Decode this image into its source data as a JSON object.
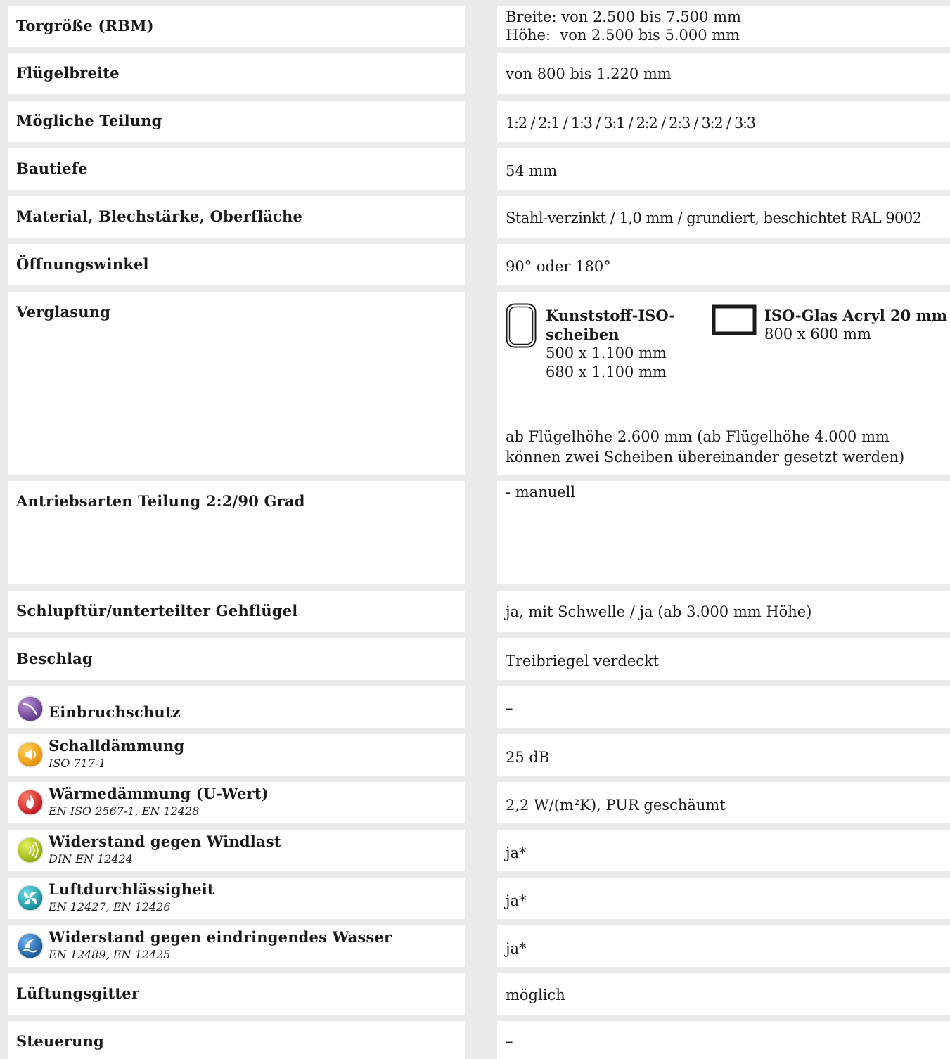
{
  "rows": [
    {
      "label": "Torgröße (RBM)",
      "value_line1": "Breite: von 2.500 bis 7.500 mm",
      "value_line2": "Höhe:  von 2.500 bis 5.000 mm"
    },
    {
      "label": "Flügelbreite",
      "value": "von 800 bis 1.220 mm"
    },
    {
      "label": "Mögliche Teilung",
      "value": "1:2 / 2:1 / 1:3 / 3:1 / 2:2 / 2:3 / 3:2 / 3:3"
    },
    {
      "label": "Bautiefe",
      "value": "54 mm"
    },
    {
      "label": "Material, Blechstärke, Oberfläche",
      "value": "Stahl-verzinkt / 1,0 mm / grundiert, beschichtet RAL 9002"
    },
    {
      "label": "Öffnungswinkel",
      "value": "90° oder 180°"
    },
    {
      "label": "Verglasung"
    },
    {
      "label": "Antriebsarten Teilung 2:2/90 Grad",
      "value": "- manuell"
    },
    {
      "label": "Schlupftür/unterteilter Gehflügel",
      "value": "ja, mit Schwelle / ja (ab 3.000 mm Höhe)"
    },
    {
      "label": "Beschlag",
      "value": "Treibriegel verdeckt"
    },
    {
      "label": "Einbruchschutz",
      "value": "–"
    },
    {
      "label": "Schalldämmung",
      "sub": "ISO 717-1",
      "value": "25 dB"
    },
    {
      "label": "Wärmedämmung (U-Wert)",
      "sub": "EN ISO 2567-1, EN 12428",
      "value": "2,2 W/(m²K), PUR geschäumt"
    },
    {
      "label": "Widerstand gegen Windlast",
      "sub": "DIN EN 12424",
      "value": "ja*"
    },
    {
      "label": "Luftdurchlässigheit",
      "sub": "EN 12427, EN 12426",
      "value": "ja*"
    },
    {
      "label": "Widerstand gegen eindringendes Wasser",
      "sub": "EN 12489, EN 12425",
      "value": "ja*"
    },
    {
      "label": "Lüftungsgitter",
      "value": "möglich"
    },
    {
      "label": "Steuerung",
      "value": "–"
    }
  ],
  "glazing": {
    "option1_title_l1": "Kunststoff-ISO-",
    "option1_title_l2": "scheiben",
    "option1_size1": "500 x 1.100 mm",
    "option1_size2": "680 x 1.100 mm",
    "option2_title": "ISO-Glas Acryl 20 mm",
    "option2_size": "800 x 600 mm",
    "note_line1": "ab Flügelhöhe 2.600 mm (ab Flügelhöhe 4.000 mm",
    "note_line2": "können zwei Scheiben übereinander gesetzt werden)"
  },
  "icon_colors": {
    "einbruch": "#7b4fa3",
    "schall": "#f4a300",
    "waerme": "#d3262b",
    "wind": "#a6c21a",
    "luft": "#12a9b5",
    "wasser": "#1e6fb8"
  }
}
